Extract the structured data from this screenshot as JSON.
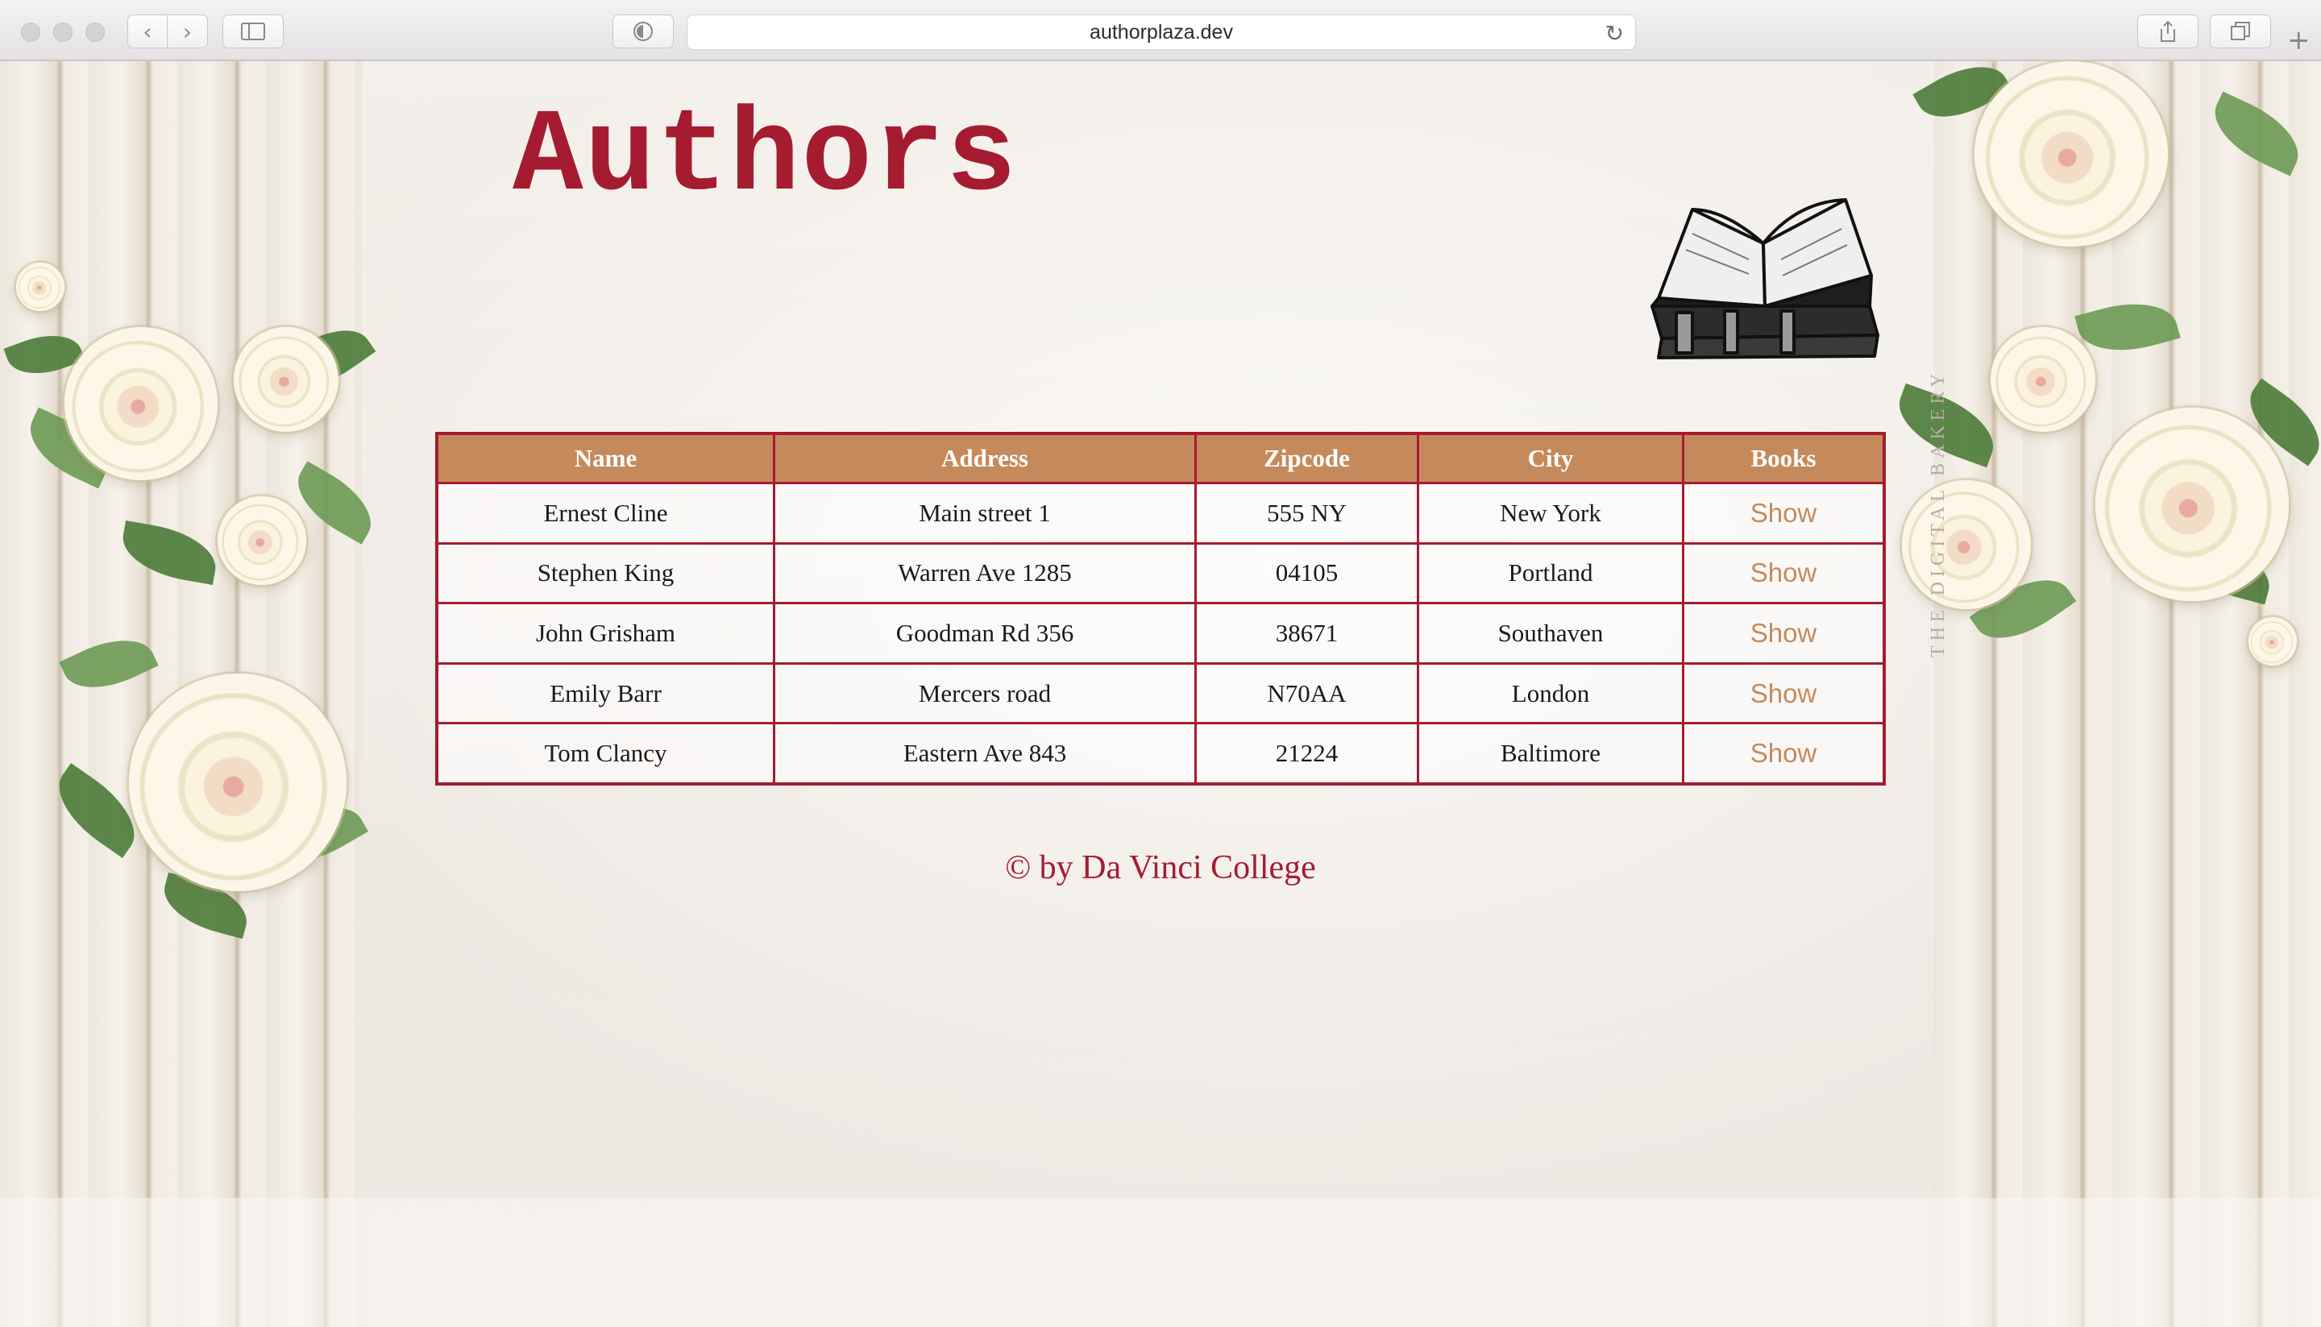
{
  "browser": {
    "url": "authorplaza.dev",
    "back_glyph": "‹",
    "forward_glyph": "›",
    "reload_glyph": "↻",
    "new_tab_glyph": "+"
  },
  "page": {
    "title": "Authors",
    "table": {
      "headers": [
        "Name",
        "Address",
        "Zipcode",
        "City",
        "Books"
      ],
      "rows": [
        {
          "name": "Ernest Cline",
          "address": "Main street 1",
          "zipcode": "555 NY",
          "city": "New York",
          "books": "Show"
        },
        {
          "name": "Stephen King",
          "address": "Warren Ave 1285",
          "zipcode": "04105",
          "city": "Portland",
          "books": "Show"
        },
        {
          "name": "John Grisham",
          "address": "Goodman Rd 356",
          "zipcode": "38671",
          "city": "Southaven",
          "books": "Show"
        },
        {
          "name": "Emily Barr",
          "address": "Mercers road",
          "zipcode": "N70AA",
          "city": "London",
          "books": "Show"
        },
        {
          "name": "Tom Clancy",
          "address": "Eastern Ave 843",
          "zipcode": "21224",
          "city": "Baltimore",
          "books": "Show"
        }
      ]
    },
    "footer": "© by Da Vinci College",
    "watermark": "THE DIGITAL BAKERY"
  },
  "colors": {
    "accent": "#a51c30",
    "header_bg": "#c58a5c",
    "link": "#c58a5c"
  }
}
